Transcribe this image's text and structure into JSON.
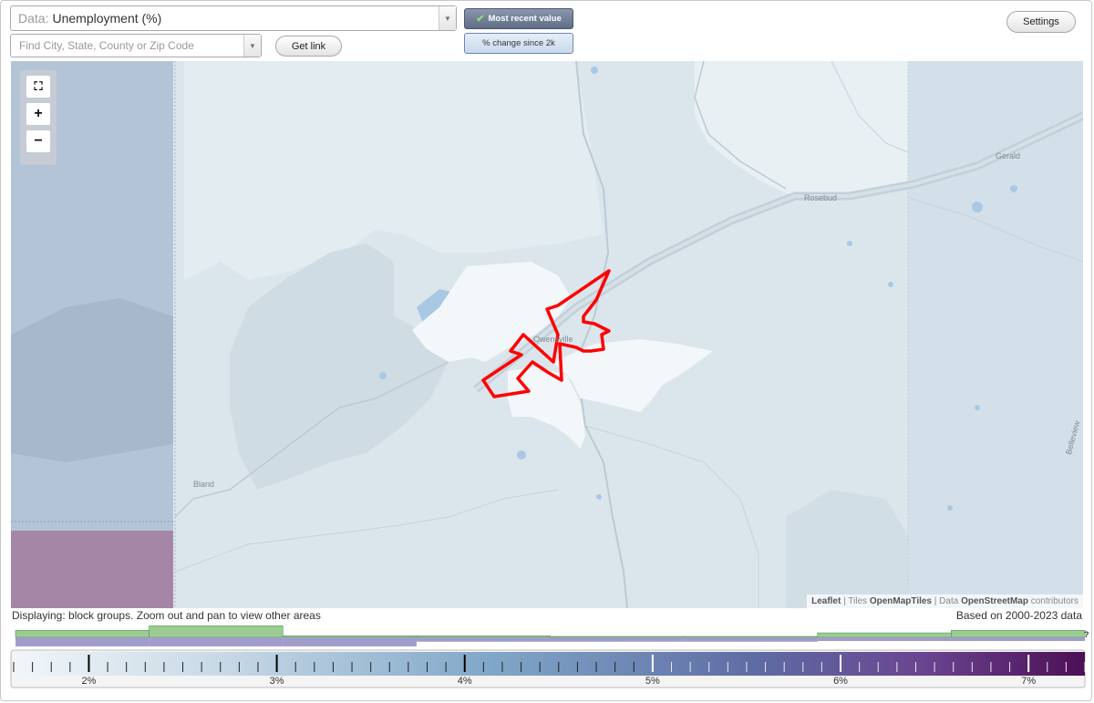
{
  "controls": {
    "data_prefix": "Data:",
    "data_value": "Unemployment (%)",
    "search_placeholder": "Find City, State, County or Zip Code",
    "get_link": "Get link",
    "most_recent": "Most recent value",
    "pct_change": "% change since 2k",
    "settings": "Settings"
  },
  "map": {
    "highlighted_place": "Owensville",
    "labels": {
      "owensville": "Owensville",
      "rosebud": "Rosebud",
      "gerald": "Gerald",
      "bland": "Bland",
      "belleview": "Belleview"
    },
    "zoom_in": "+",
    "zoom_out": "−",
    "attribution": {
      "leaflet": "Leaflet",
      "tiles_prefix": "| Tiles",
      "tiles": "OpenMapTiles",
      "data_prefix": "| Data",
      "data": "OpenStreetMap",
      "contributors": "contributors"
    },
    "colors": {
      "outline": "#ff0000",
      "left_band": "#b3c4d6",
      "purple_block": "#a686a6",
      "town": "#f3f7f9"
    }
  },
  "footer": {
    "displaying": "Displaying: block groups. Zoom out and pan to view other areas",
    "based_on": "Based on 2000-2023 data",
    "legend_question": "?"
  },
  "legend": {
    "tick_labels": [
      "2%",
      "3%",
      "4%",
      "5%",
      "6%",
      "7%"
    ],
    "range_min_pct": 1.6,
    "range_max_pct": 7.3,
    "histogram_green": [
      0.55,
      0.9,
      0.12,
      0.12,
      0.02,
      0.02,
      0.35,
      0.55
    ],
    "histogram_purple": [
      0.62,
      0.62,
      0.62,
      0.3,
      0.3,
      0.3,
      0.25,
      0.25
    ]
  }
}
